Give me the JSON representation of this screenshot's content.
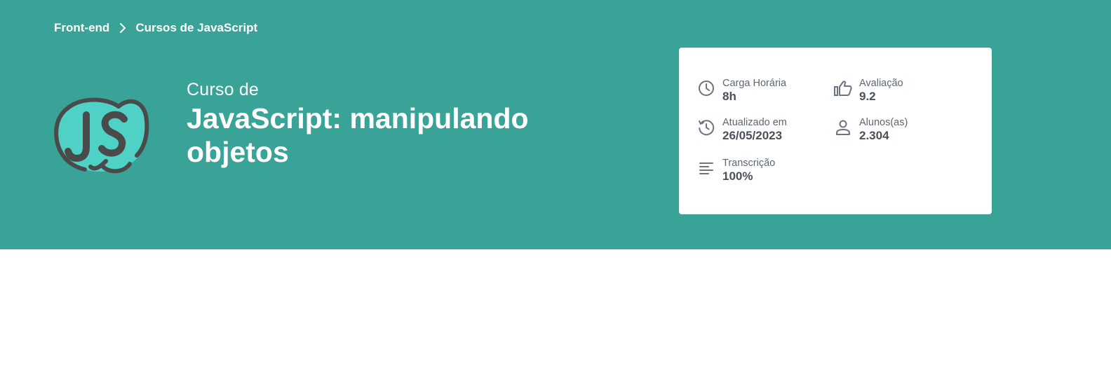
{
  "breadcrumb": {
    "items": [
      {
        "label": "Front-end"
      },
      {
        "label": "Cursos de JavaScript"
      }
    ]
  },
  "hero": {
    "background_color": "#39a398",
    "prefix": "Curso de",
    "title_line1": "JavaScript: manipulando",
    "title_line2": "objetos",
    "logo_icon": "javascript-logo-icon"
  },
  "stats": {
    "workload": {
      "label": "Carga Horária",
      "value": "8h",
      "icon": "clock-icon"
    },
    "rating": {
      "label": "Avaliação",
      "value": "9.2",
      "icon": "thumbs-up-icon"
    },
    "updated": {
      "label": "Atualizado em",
      "value": "26/05/2023",
      "icon": "history-clock-icon"
    },
    "students": {
      "label": "Alunos(as)",
      "value": "2.304",
      "icon": "user-icon"
    },
    "transcript": {
      "label": "Transcrição",
      "value": "100%",
      "icon": "text-lines-icon"
    }
  },
  "colors": {
    "icon_gray": "#6b7480",
    "label_gray": "#5c6670",
    "value_gray": "#4b5159",
    "logo_fill": "#4fd1c6",
    "logo_stroke": "#4a4a4a"
  }
}
